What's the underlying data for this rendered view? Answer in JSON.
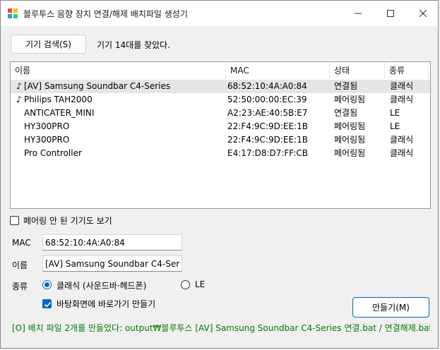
{
  "window": {
    "title": "블루투스 음향 장치 연결/해제 배치파일 생성기"
  },
  "toolbar": {
    "search_label": "기기 검색(S)",
    "found_text": "기기 14대를 찾았다."
  },
  "devices": {
    "columns": [
      "이름",
      "MAC",
      "상태",
      "종류"
    ],
    "rows": [
      {
        "icon": "music-note-icon",
        "name": "[AV] Samsung Soundbar C4-Series",
        "mac": "68:52:10:4A:A0:84",
        "state": "연결됨",
        "type": "클래식",
        "selected": true
      },
      {
        "icon": "music-note-icon",
        "name": "Philips TAH2000",
        "mac": "52:50:00:00:EC:39",
        "state": "페어링됨",
        "type": "클래식",
        "selected": false
      },
      {
        "icon": "",
        "name": "ANTICATER_MINI",
        "mac": "A2:23:AE:40:5B:E7",
        "state": "연결됨",
        "type": "LE",
        "selected": false
      },
      {
        "icon": "",
        "name": "HY300PRO",
        "mac": "22:F4:9C:9D:EE:1B",
        "state": "페어링됨",
        "type": "LE",
        "selected": false
      },
      {
        "icon": "",
        "name": "HY300PRO",
        "mac": "22:F4:9C:9D:EE:1B",
        "state": "페어링됨",
        "type": "클래식",
        "selected": false
      },
      {
        "icon": "",
        "name": "Pro Controller",
        "mac": "E4:17:D8:D7:FF:CB",
        "state": "페어링됨",
        "type": "클래식",
        "selected": false
      }
    ]
  },
  "options": {
    "show_unpaired_label": "페어링 안 된 기기도 보기",
    "show_unpaired_checked": false
  },
  "form": {
    "mac_label": "MAC",
    "mac_value": "68:52:10:4A:A0:84",
    "name_label": "이름",
    "name_value": "[AV] Samsung Soundbar C4-Series",
    "type_label": "종류",
    "type_classic_label": "클래식 (사운드바·헤드폰)",
    "type_le_label": "LE",
    "type_selected": "classic",
    "shortcut_label": "바탕화면에 바로가기 만들기",
    "shortcut_checked": true,
    "make_label": "만들기(M)"
  },
  "status": {
    "text": "[O] 배치 파일 2개를 만들었다: output₩블루투스 [AV] Samsung Soundbar C4-Series 연결.bat / 연결해제.bat ·",
    "color": "#007a00"
  },
  "colors": {
    "accent": "#0067c0",
    "selection": "#e5e5e5"
  }
}
